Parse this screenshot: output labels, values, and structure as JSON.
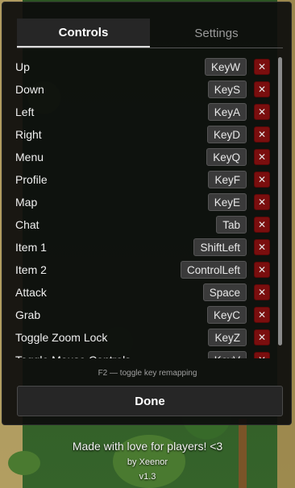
{
  "tabs": [
    {
      "label": "Controls",
      "active": true
    },
    {
      "label": "Settings",
      "active": false
    }
  ],
  "controls": [
    {
      "action": "Up",
      "key": "KeyW"
    },
    {
      "action": "Down",
      "key": "KeyS"
    },
    {
      "action": "Left",
      "key": "KeyA"
    },
    {
      "action": "Right",
      "key": "KeyD"
    },
    {
      "action": "Menu",
      "key": "KeyQ"
    },
    {
      "action": "Profile",
      "key": "KeyF"
    },
    {
      "action": "Map",
      "key": "KeyE"
    },
    {
      "action": "Chat",
      "key": "Tab"
    },
    {
      "action": "Item 1",
      "key": "ShiftLeft"
    },
    {
      "action": "Item 2",
      "key": "ControlLeft"
    },
    {
      "action": "Attack",
      "key": "Space"
    },
    {
      "action": "Grab",
      "key": "KeyC"
    },
    {
      "action": "Toggle Zoom Lock",
      "key": "KeyZ"
    },
    {
      "action": "Toggle Mouse Controls",
      "key": "KeyV"
    }
  ],
  "clear_glyph": "✕",
  "hint": "F2 — toggle key remapping",
  "done_label": "Done",
  "credits": {
    "line1": "Made with love for players! <3",
    "line2": "by Xeenor",
    "line3": "v1.3"
  },
  "colors": {
    "clear_button": "#7a0e0e",
    "panel": "#0c0c0c"
  }
}
